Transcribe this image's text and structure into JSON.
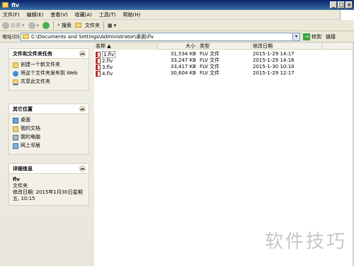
{
  "window": {
    "title": "flv"
  },
  "menu": [
    "文件(F)",
    "编辑(E)",
    "查看(V)",
    "收藏(A)",
    "工具(T)",
    "帮助(H)"
  ],
  "toolbar": {
    "back": "后退",
    "search": "搜索",
    "folders": "文件夹"
  },
  "address": {
    "label": "地址(D)",
    "path": "C:\\Documents and Settings\\Administrator\\桌面\\flv",
    "go": "转到",
    "links": "链接"
  },
  "side": {
    "tasks": {
      "title": "文件和文件夹任务",
      "items": [
        "创建一个新文件夹",
        "将这个文件夹发布到 Web",
        "共享此文件夹"
      ]
    },
    "places": {
      "title": "其它位置",
      "items": [
        "桌面",
        "我的文档",
        "我的电脑",
        "网上邻居"
      ]
    },
    "details": {
      "title": "详细信息",
      "name": "flv",
      "kind": "文件夹",
      "modified": "修改日期: 2015年1月30日星期五, 10:15"
    }
  },
  "columns": {
    "name": "名称",
    "size": "大小",
    "type": "类型",
    "date": "修改日期"
  },
  "files": [
    {
      "name": "1.flv",
      "size": "31,534 KB",
      "type": "FLV 文件",
      "date": "2015-1-29 14:17"
    },
    {
      "name": "2.flv",
      "size": "33,247 KB",
      "type": "FLV 文件",
      "date": "2015-1-29 14:16"
    },
    {
      "name": "3.flv",
      "size": "33,417 KB",
      "type": "FLV 文件",
      "date": "2015-1-30 10:10"
    },
    {
      "name": "4.flv",
      "size": "30,604 KB",
      "type": "FLV 文件",
      "date": "2015-1-29 12:17"
    }
  ],
  "watermark": "软件技巧"
}
